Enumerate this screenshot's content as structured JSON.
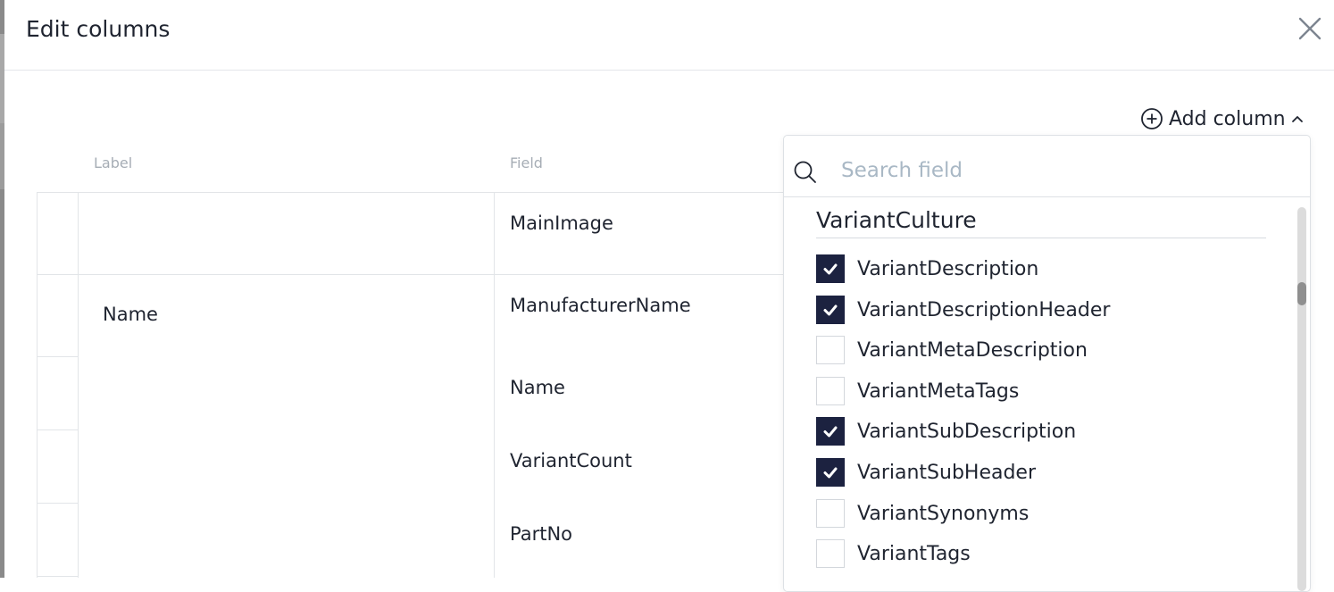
{
  "dialog": {
    "title": "Edit columns"
  },
  "toolbar": {
    "add_column_label": "Add column"
  },
  "table": {
    "headers": {
      "label": "Label",
      "field": "Field"
    },
    "rows": [
      {
        "label": "",
        "field": "MainImage"
      },
      {
        "label": "Name",
        "field": "ManufacturerName"
      },
      {
        "label": "",
        "field": "Name"
      },
      {
        "label": "",
        "field": "VariantCount"
      },
      {
        "label": "",
        "field": "PartNo"
      }
    ]
  },
  "dropdown": {
    "search_placeholder": "Search field",
    "search_value": "",
    "group_title": "VariantCulture",
    "options": [
      {
        "label": "VariantDescription",
        "checked": true
      },
      {
        "label": "VariantDescriptionHeader",
        "checked": true
      },
      {
        "label": "VariantMetaDescription",
        "checked": false
      },
      {
        "label": "VariantMetaTags",
        "checked": false
      },
      {
        "label": "VariantSubDescription",
        "checked": true
      },
      {
        "label": "VariantSubHeader",
        "checked": true
      },
      {
        "label": "VariantSynonyms",
        "checked": false
      },
      {
        "label": "VariantTags",
        "checked": false
      }
    ]
  },
  "colors": {
    "accent": "#1c2240",
    "placeholder": "#a9b8c5"
  },
  "icons": {
    "close": "close-icon",
    "add": "plus-circle-icon",
    "caret": "chevron-up-icon",
    "search": "search-icon",
    "check": "check-icon"
  }
}
